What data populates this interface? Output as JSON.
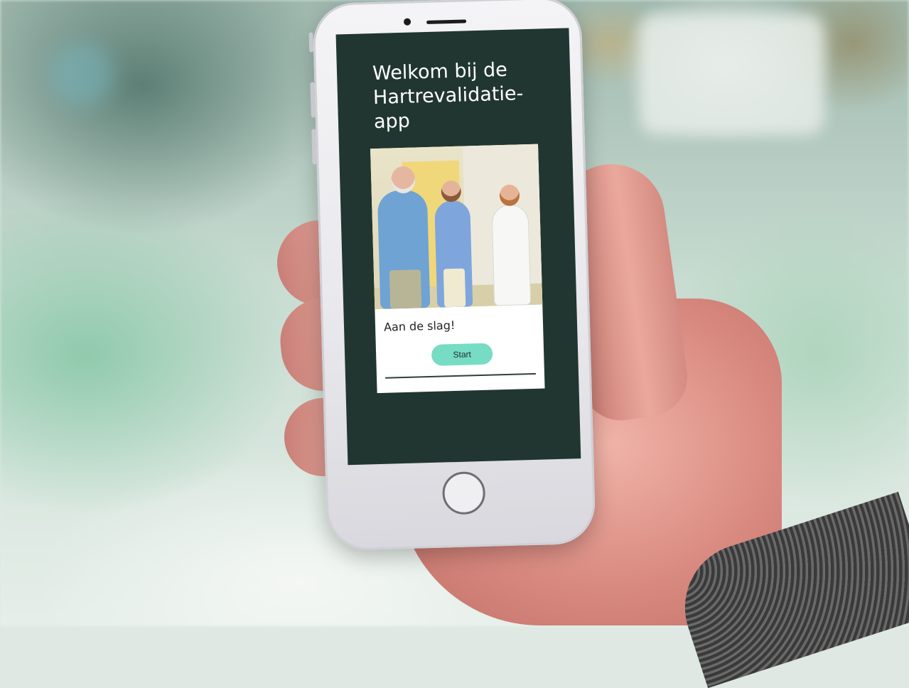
{
  "app": {
    "welcome_line1": "Welkom bij de",
    "welcome_line2": "Hartrevalidatie-app"
  },
  "card": {
    "title": "Aan de slag!",
    "start_label": "Start"
  },
  "colors": {
    "screen_background": "#213630",
    "start_button": "#77dcc4",
    "card_background": "#ffffff",
    "welcome_text": "#ffffff"
  },
  "icons": {
    "home_button": "home-button-icon"
  }
}
